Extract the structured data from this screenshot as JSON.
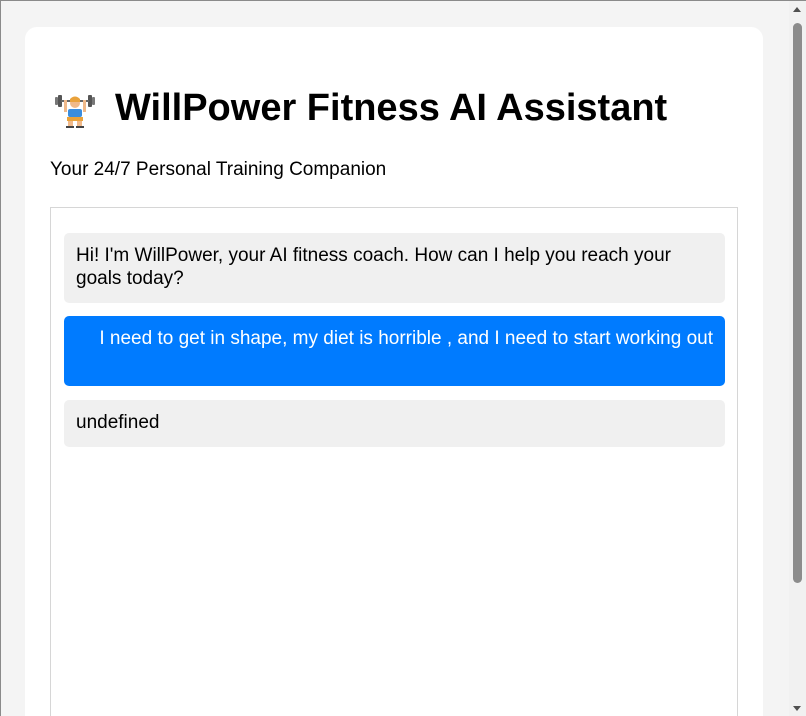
{
  "header": {
    "icon": "weightlifter-icon",
    "title": "WillPower Fitness AI Assistant",
    "subtitle": "Your 24/7 Personal Training Companion"
  },
  "chat": {
    "messages": [
      {
        "role": "bot",
        "text": "Hi! I'm WillPower, your AI fitness coach. How can I help you reach your goals today?"
      },
      {
        "role": "user",
        "text": "I need to get in shape, my diet is horrible , and I need to start working out"
      },
      {
        "role": "bot",
        "text": "undefined"
      }
    ]
  },
  "colors": {
    "user_bubble": "#007bff",
    "bot_bubble": "#f0f0f0",
    "page_background": "#f4f4f4"
  }
}
